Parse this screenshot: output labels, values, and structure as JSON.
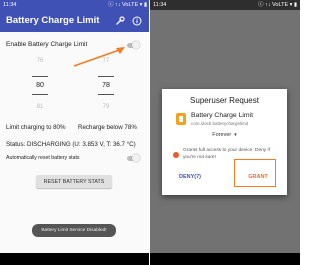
{
  "left": {
    "status_time": "11:34",
    "status_right": "ⓒ ↑↓ VoLTE ▾ ▮",
    "app_title": "Battery Charge Limit",
    "enable_label": "Enable Battery Charge Limit",
    "picker_left": [
      "76",
      "80",
      "81"
    ],
    "picker_right": [
      "77",
      "78",
      "79"
    ],
    "limit_text": "Limit charging to 80%",
    "recharge_text": "Recharge below 78%",
    "status_text": "Status: DISCHARGING (U: 3.853 V, T: 36.7 °C)",
    "auto_reset_label": "Automatically reset battery stats",
    "reset_button": "RESET BATTERY STATS",
    "toast": "Battery Limit Service Disabled!"
  },
  "right": {
    "status_time": "11:34",
    "status_right": "ⓒ ↑↓ VoLTE ▾ ▮",
    "dialog_title": "Superuser Request",
    "app_name": "Battery Charge Limit",
    "package": "com.slosh.batterychargelimit",
    "duration": "Forever",
    "warning": "Grants full access to your device. Deny if you're not sure!",
    "deny_label": "DENY(7)",
    "grant_label": "GRANT"
  },
  "colors": {
    "primary": "#3f51b5",
    "accent": "#f57c20",
    "warning_dot": "#f05a26"
  },
  "icons": [
    "wrench-icon",
    "info-icon",
    "app-icon",
    "dropdown-icon"
  ]
}
